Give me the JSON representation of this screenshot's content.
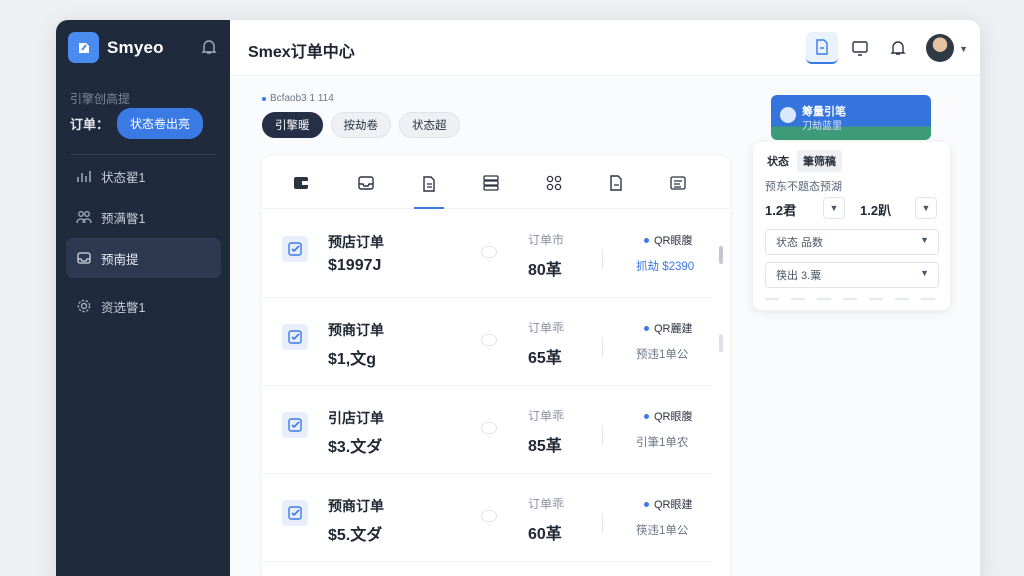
{
  "brand": {
    "name": "Smyeo"
  },
  "sidebar": {
    "section_title": "引擎创高提",
    "filter_label": "订单：",
    "filter_pill": "状态卷出亮",
    "items": [
      {
        "label": "状态翟1",
        "icon": "chart-bars-icon"
      },
      {
        "label": "预满瞥1",
        "icon": "people-icon"
      },
      {
        "label": "预南提",
        "icon": "inbox-icon"
      },
      {
        "label": "资选瞥1",
        "icon": "gear-icon"
      }
    ]
  },
  "header": {
    "title": "Smex订单中心"
  },
  "breadcrumb": "Bcfaob3 1 114",
  "chips": [
    "引擎暖",
    "按劫卷",
    "状态超"
  ],
  "card": {
    "tabs": [
      "wallet-icon",
      "inbox-tray-icon",
      "document-icon",
      "stack-icon",
      "grid-icon",
      "file-icon",
      "list-icon"
    ],
    "rows": [
      {
        "name": "预店订单",
        "price": "$1997J",
        "qty_label": "订单市",
        "qty": "80革",
        "status": "QR眼腹",
        "sub": "抓劫 $2390"
      },
      {
        "name": "预商订单",
        "price": "$1,文g",
        "qty_label": "订单乖",
        "qty": "65革",
        "status": "QR麗建",
        "sub": "预违1单公"
      },
      {
        "name": "引店订单",
        "price": "$3.文ダ",
        "qty_label": "订单乖",
        "qty": "85革",
        "status": "QR眼腹",
        "sub": "引筆1单农"
      },
      {
        "name": "预商订单",
        "price": "$5.文ダ",
        "qty_label": "订单乖",
        "qty": "60革",
        "status": "QR眼建",
        "sub": "筷违1单公"
      }
    ]
  },
  "promo": {
    "title": "筹量引笔",
    "sub": "刀劫蓝里"
  },
  "panel": {
    "tabs": [
      "状态",
      "筆筛稿"
    ],
    "label": "预东不题态预湖",
    "value_left": "1.2君",
    "value_right": "1.2趴",
    "select1": "状态 品数",
    "select2": "筷出 3.粟"
  },
  "colors": {
    "accent": "#3a7ae4",
    "sidebar_bg": "#1f2a3d",
    "sidebar_active": "#2d3950"
  }
}
